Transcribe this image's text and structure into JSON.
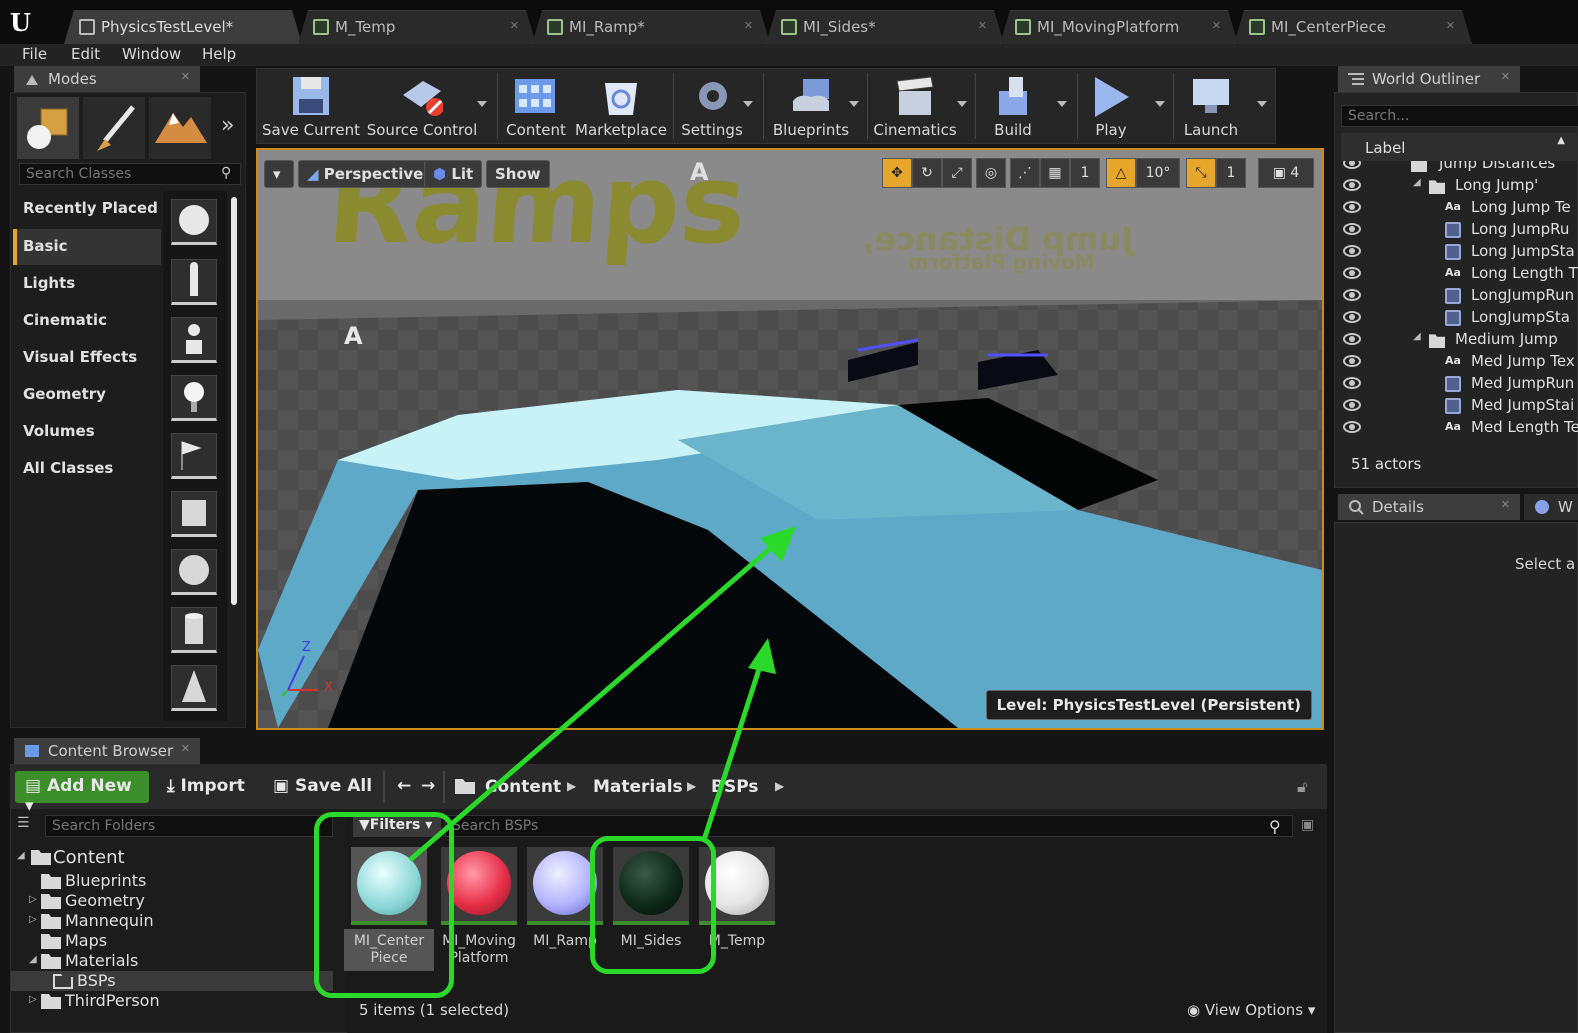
{
  "tabs": [
    {
      "label": "PhysicsTestLevel*",
      "active": true
    },
    {
      "label": "M_Temp"
    },
    {
      "label": "MI_Ramp*"
    },
    {
      "label": "MI_Sides*"
    },
    {
      "label": "MI_MovingPlatform"
    },
    {
      "label": "MI_CenterPiece"
    }
  ],
  "menu": [
    "File",
    "Edit",
    "Window",
    "Help"
  ],
  "modes": {
    "tab_label": "Modes",
    "search_placeholder": "Search Classes",
    "categories": [
      "Recently Placed",
      "Basic",
      "Lights",
      "Cinematic",
      "Visual Effects",
      "Geometry",
      "Volumes",
      "All Classes"
    ],
    "selected_category": "Basic",
    "mode_icons": [
      "place-mode-icon",
      "paint-mode-icon",
      "landscape-mode-icon"
    ],
    "shape_icons": [
      "sphere-icon",
      "character-icon",
      "pawn-icon",
      "point-light-icon",
      "player-start-icon",
      "cube-icon",
      "sphere-icon",
      "cylinder-icon",
      "cone-icon"
    ]
  },
  "toolbar": [
    {
      "label": "Save Current",
      "icon": "save-icon"
    },
    {
      "label": "Source Control",
      "icon": "source-control-icon"
    },
    {
      "label": "Content",
      "icon": "content-icon"
    },
    {
      "label": "Marketplace",
      "icon": "marketplace-icon"
    },
    {
      "label": "Settings",
      "icon": "settings-icon"
    },
    {
      "label": "Blueprints",
      "icon": "blueprints-icon"
    },
    {
      "label": "Cinematics",
      "icon": "cinematics-icon"
    },
    {
      "label": "Build",
      "icon": "build-icon"
    },
    {
      "label": "Play",
      "icon": "play-icon"
    },
    {
      "label": "Launch",
      "icon": "launch-icon"
    }
  ],
  "viewport": {
    "perspective_label": "Perspective",
    "lit_label": "Lit",
    "show_label": "Show",
    "snap_rotation": "10°",
    "snap_grid": "1",
    "snap_scale": "1",
    "camera_speed": "4",
    "level_label": "Level:  PhysicsTestLevel (Persistent)",
    "scene_text_ramps": "Ramps",
    "scene_text_jump": "Jump Distance,",
    "scene_text_moving": "Moving Platform",
    "scene_marker_a": "A",
    "axis_x": "X",
    "axis_z": "Z"
  },
  "outliner": {
    "tab_label": "World Outliner",
    "search_placeholder": "Search...",
    "column_label": "Label",
    "rows": [
      {
        "label": "Jump Distances",
        "indent": 1,
        "icon": "folder"
      },
      {
        "label": "Long Jump'",
        "indent": 2,
        "icon": "folder",
        "expanded": true
      },
      {
        "label": "Long Jump Te",
        "indent": 3,
        "icon": "text"
      },
      {
        "label": "Long JumpRu",
        "indent": 3,
        "icon": "actor"
      },
      {
        "label": "Long JumpSta",
        "indent": 3,
        "icon": "actor"
      },
      {
        "label": "Long Length T",
        "indent": 3,
        "icon": "text"
      },
      {
        "label": "LongJumpRun",
        "indent": 3,
        "icon": "actor"
      },
      {
        "label": "LongJumpSta",
        "indent": 3,
        "icon": "actor"
      },
      {
        "label": "Medium Jump",
        "indent": 2,
        "icon": "folder",
        "expanded": true
      },
      {
        "label": "Med Jump Tex",
        "indent": 3,
        "icon": "text"
      },
      {
        "label": "Med JumpRun",
        "indent": 3,
        "icon": "actor"
      },
      {
        "label": "Med JumpStai",
        "indent": 3,
        "icon": "actor"
      },
      {
        "label": "Med Length Te",
        "indent": 3,
        "icon": "text"
      }
    ],
    "actor_count": "51 actors"
  },
  "details": {
    "tab_label": "Details",
    "second_tab_label": "W",
    "empty_text": "Select a"
  },
  "content_browser": {
    "tab_label": "Content Browser",
    "add_new_label": "Add New",
    "import_label": "Import",
    "save_all_label": "Save All",
    "breadcrumb": [
      "Content",
      "Materials",
      "BSPs"
    ],
    "folder_search_placeholder": "Search Folders",
    "filters_label": "Filters",
    "asset_search_placeholder": "Search BSPs",
    "tree": [
      {
        "label": "Content",
        "depth": 0,
        "expanded": true
      },
      {
        "label": "Blueprints",
        "depth": 1
      },
      {
        "label": "Geometry",
        "depth": 1,
        "collapsed": true
      },
      {
        "label": "Mannequin",
        "depth": 1,
        "collapsed": true
      },
      {
        "label": "Maps",
        "depth": 1
      },
      {
        "label": "Materials",
        "depth": 1,
        "expanded": true
      },
      {
        "label": "BSPs",
        "depth": 2,
        "selected": true
      },
      {
        "label": "ThirdPerson",
        "depth": 1,
        "collapsed": true
      }
    ],
    "assets": [
      {
        "label": "MI_Center Piece",
        "color": "#b8ecec",
        "selected": true
      },
      {
        "label": "MI_Moving Platform",
        "color": "#e8304a"
      },
      {
        "label": "MI_Ramp",
        "color": "#b4b4ff"
      },
      {
        "label": "MI_Sides",
        "color": "#0f2a1a"
      },
      {
        "label": "M_Temp",
        "color": "#e6e6e6"
      }
    ],
    "status": "5 items (1 selected)",
    "view_options_label": "View Options"
  },
  "annotation_color": "#2bd92b"
}
